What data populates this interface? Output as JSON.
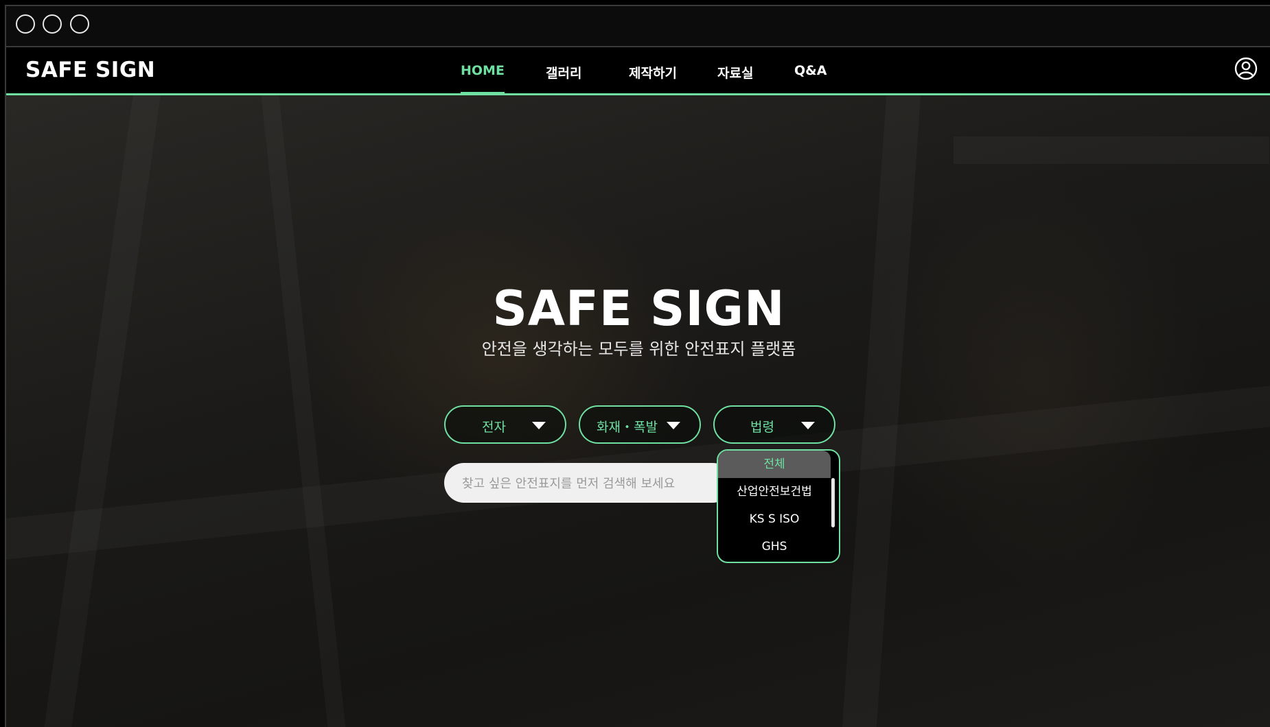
{
  "window": {
    "controls": [
      "window-dot",
      "window-dot",
      "window-dot"
    ]
  },
  "navbar": {
    "logo": "SAFE SIGN",
    "items": [
      {
        "label": "HOME",
        "active": true
      },
      {
        "label": "갤러리",
        "active": false
      },
      {
        "label": "제작하기",
        "active": false
      },
      {
        "label": "자료실",
        "active": false
      },
      {
        "label": "Q&A",
        "active": false
      }
    ],
    "user_icon": "user-circle-icon"
  },
  "hero": {
    "title": "SAFE SIGN",
    "subtitle": "안전을 생각하는 모두를 위한 안전표지 플랫폼"
  },
  "filters": [
    {
      "label": "전자",
      "icon": "caret-down-icon"
    },
    {
      "label": "화재・폭발",
      "icon": "caret-down-icon"
    },
    {
      "label": "법령",
      "icon": "caret-down-icon"
    }
  ],
  "search": {
    "placeholder": "찾고 싶은 안전표지를 먼저 검색해 보세요",
    "value": ""
  },
  "law_dropdown": {
    "options": [
      "전체",
      "산업안전보건법",
      "KS S ISO",
      "GHS"
    ],
    "selected": "전체"
  },
  "colors": {
    "accent": "#6fe0a2",
    "background": "#000000",
    "text": "#ffffff"
  }
}
